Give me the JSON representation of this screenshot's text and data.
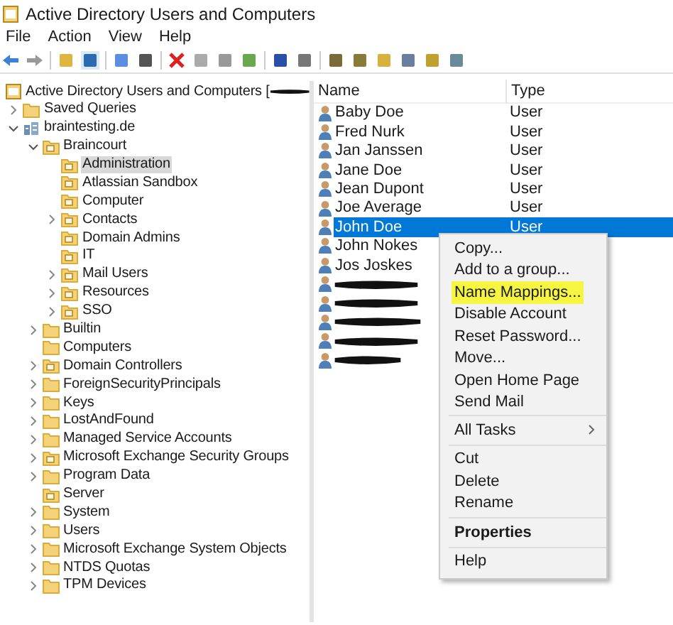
{
  "window": {
    "title": "Active Directory Users and Computers"
  },
  "menu": [
    "File",
    "Action",
    "View",
    "Help"
  ],
  "tree": {
    "label": "Active Directory Users and Computers [",
    "redacted": true,
    "children": [
      {
        "label": "Saved Queries",
        "kind": "folder",
        "expanded": false
      },
      {
        "label": "braintesting.de",
        "kind": "domain",
        "expanded": true,
        "children": [
          {
            "label": "Braincourt",
            "kind": "ou",
            "expanded": true,
            "children": [
              {
                "label": "Administration",
                "kind": "ou",
                "selected": true
              },
              {
                "label": "Atlassian Sandbox",
                "kind": "ou",
                "selected": false
              },
              {
                "label": "Computer",
                "kind": "ou",
                "selected": false
              },
              {
                "label": "Contacts",
                "kind": "ou",
                "expanded": false,
                "selected": false
              },
              {
                "label": "Domain Admins",
                "kind": "ou",
                "selected": false
              },
              {
                "label": "IT",
                "kind": "ou",
                "selected": false
              },
              {
                "label": "Mail Users",
                "kind": "ou",
                "expanded": false,
                "selected": false
              },
              {
                "label": "Resources",
                "kind": "ou",
                "expanded": false,
                "selected": false
              },
              {
                "label": "SSO",
                "kind": "ou",
                "expanded": false,
                "selected": false
              }
            ]
          },
          {
            "label": "Builtin",
            "kind": "folder",
            "expanded": false
          },
          {
            "label": "Computers",
            "kind": "folder"
          },
          {
            "label": "Domain Controllers",
            "kind": "ou",
            "expanded": false
          },
          {
            "label": "ForeignSecurityPrincipals",
            "kind": "folder",
            "expanded": false
          },
          {
            "label": "Keys",
            "kind": "folder",
            "expanded": false
          },
          {
            "label": "LostAndFound",
            "kind": "folder",
            "expanded": false
          },
          {
            "label": "Managed Service Accounts",
            "kind": "folder",
            "expanded": false
          },
          {
            "label": "Microsoft Exchange Security Groups",
            "kind": "ou",
            "expanded": false
          },
          {
            "label": "Program Data",
            "kind": "folder",
            "expanded": false
          },
          {
            "label": "Server",
            "kind": "ou"
          },
          {
            "label": "System",
            "kind": "folder",
            "expanded": false
          },
          {
            "label": "Users",
            "kind": "folder",
            "expanded": false
          },
          {
            "label": "Microsoft Exchange System Objects",
            "kind": "folder",
            "expanded": false
          },
          {
            "label": "NTDS Quotas",
            "kind": "folder",
            "expanded": false
          },
          {
            "label": "TPM Devices",
            "kind": "folder",
            "expanded": false
          }
        ]
      }
    ]
  },
  "list": {
    "columns": [
      "Name",
      "Type"
    ],
    "rows": [
      {
        "name": "Baby Doe",
        "type": "User",
        "selected": false
      },
      {
        "name": "Fred Nurk",
        "type": "User",
        "selected": false
      },
      {
        "name": "Jan Janssen",
        "type": "User",
        "selected": false
      },
      {
        "name": "Jane Doe",
        "type": "User",
        "selected": false
      },
      {
        "name": "Jean Dupont",
        "type": "User",
        "selected": false
      },
      {
        "name": "Joe Average",
        "type": "User",
        "selected": false
      },
      {
        "name": "John Doe",
        "type": "User",
        "selected": true
      },
      {
        "name": "John Nokes",
        "selected": false
      },
      {
        "name": "Jos Joskes",
        "selected": false
      },
      {
        "redacted": true,
        "selected": false
      },
      {
        "redacted": true,
        "selected": false
      },
      {
        "redacted": true,
        "selected": false
      },
      {
        "redacted": true,
        "selected": false
      },
      {
        "redacted": true,
        "selected": false
      }
    ]
  },
  "context_menu": {
    "sections": [
      [
        {
          "label": "Copy..."
        },
        {
          "label": "Add to a group..."
        },
        {
          "label": "Name Mappings...",
          "highlighted": true
        },
        {
          "label": "Disable Account"
        },
        {
          "label": "Reset Password..."
        },
        {
          "label": "Move..."
        },
        {
          "label": "Open Home Page"
        },
        {
          "label": "Send Mail"
        }
      ],
      [
        {
          "label": "All Tasks",
          "submenu": true
        }
      ],
      [
        {
          "label": "Cut"
        },
        {
          "label": "Delete"
        },
        {
          "label": "Rename"
        }
      ],
      [
        {
          "label": "Properties",
          "bold": true
        }
      ],
      [
        {
          "label": "Help"
        }
      ]
    ]
  }
}
